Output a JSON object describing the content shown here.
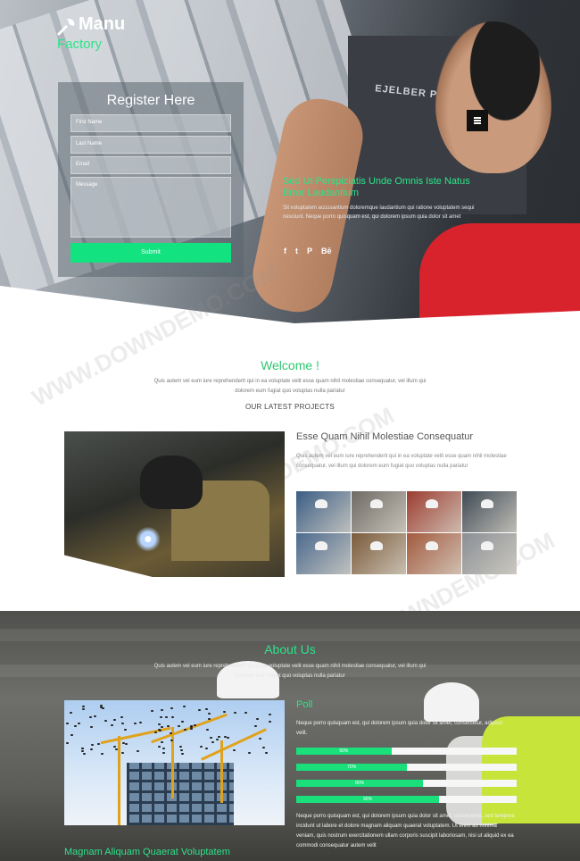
{
  "brand": {
    "name": "Manu",
    "sub": "Factory"
  },
  "hero": {
    "machine_text": "EJELBER PEEDMAST",
    "heading": "Sed Ut Perspiciatis Unde Omnis Iste Natus Error Laudantium",
    "text": "Sit voluptatem accusantium doloremque laudantium qui ratione voluptatem sequi nesciunt. Neque porro quisquam est, qui dolorem ipsum quia dolor sit amet",
    "social": [
      "f",
      "t",
      "P",
      "Bē"
    ]
  },
  "register": {
    "title": "Register Here",
    "fields": [
      "First Name",
      "Last Name",
      "Email",
      "Message"
    ],
    "submit": "Submit"
  },
  "watermark": {
    "text": "WWW.DOWNDEMO.COM"
  },
  "welcome": {
    "title": "Welcome !",
    "text": "Quis autem vel eum iure reprehenderit qui in ea voluptate velit esse quam nihil molestiae consequatur, vel illum qui dolorem eum fugiat quo voluptas nulla pariatur",
    "projects_title": "OUR LATEST PROJECTS"
  },
  "project": {
    "title": "Esse Quam Nihil Molestiae Consequatur",
    "text": "Quis autem vel eum iure reprehenderit qui in ea voluptate velit esse quam nihil molestiae consequatur, vel illum qui dolorem eum fugiat quo voluptas nulla pariatur",
    "grid_colors": [
      "#3b5d84",
      "#6e6a64",
      "#9b3d2f",
      "#3f4a55",
      "#4c6a8e",
      "#7b5a3a",
      "#a35a3e",
      "#8a8f95"
    ]
  },
  "about": {
    "title": "About Us",
    "text": "Quis autem vel eum iure reprehenderit qui in ea voluptate velit esse quam nihil molestiae consequatur, vel illum qui dolorem eum fugiat quo voluptas nulla pariatur",
    "caption": "Magnam Aliquam Quaerat Voluptatem",
    "poll_title": "Poll",
    "poll_text": "Neque porro quisquam est, qui dolorem ipsum quia dolor sit amet, consectetur, adipisci velit.",
    "bars": [
      {
        "label": "60%",
        "value": 0.6
      },
      {
        "label": "70%",
        "value": 0.7
      },
      {
        "label": "80%",
        "value": 0.8
      },
      {
        "label": "90%",
        "value": 0.9
      }
    ],
    "poll_text2": "Neque porro quisquam est, qui dolorem ipsum quia dolor sit amet, consectetur, sed tempora incidunt ut labore et dolore magnam aliquam quaerat voluptatem. Ut enim ad minima veniam, quis nostrum exercitationem ullam corporis suscipit laboriosam, nisi ut aliquid ex ea commodi consequatur autem velit"
  },
  "colors": {
    "accent": "#2de38a",
    "button": "#12e27f"
  }
}
